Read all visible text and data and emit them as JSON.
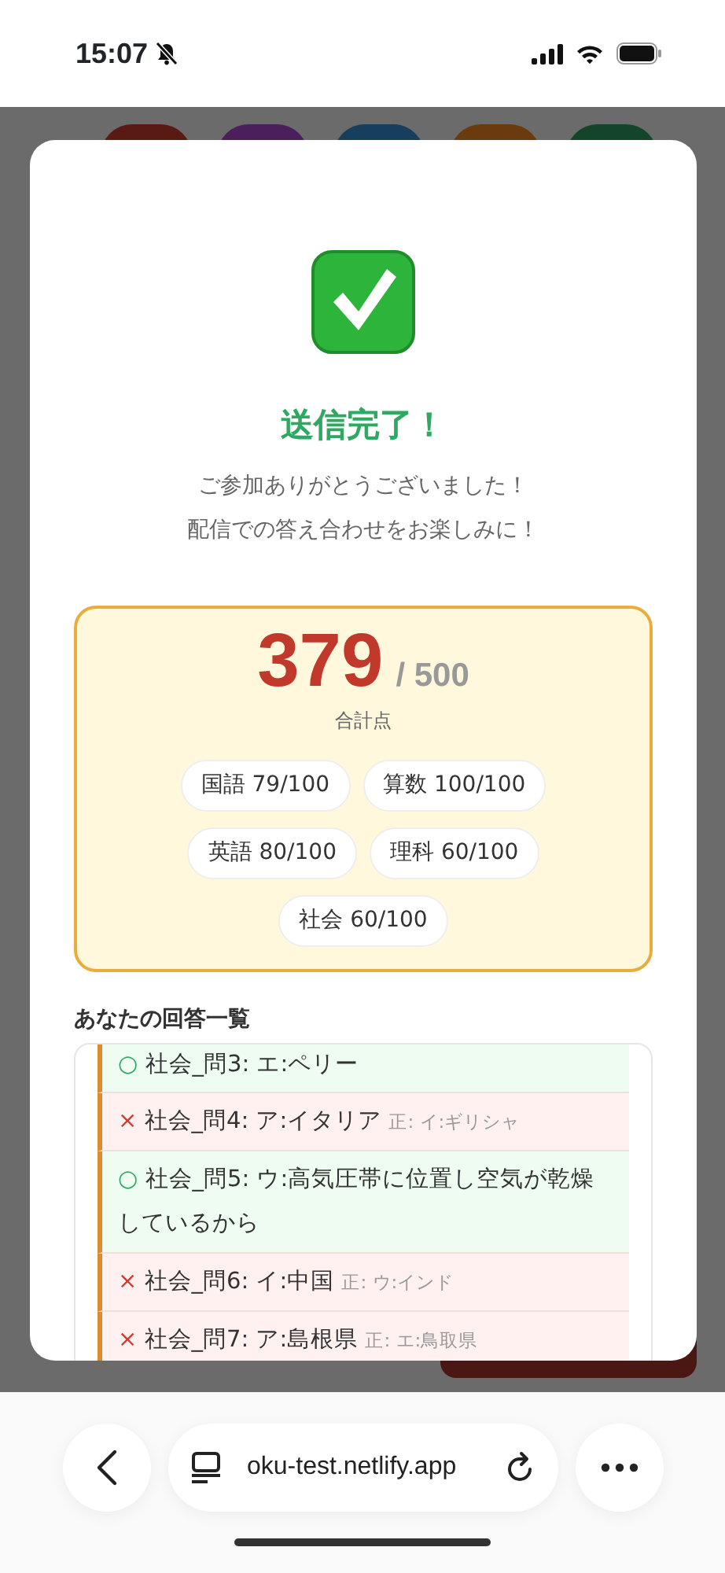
{
  "status_bar": {
    "time": "15:07",
    "silent": true
  },
  "background_tabs": [
    {
      "color": "#5a1a14"
    },
    {
      "color": "#4a1f5c"
    },
    {
      "color": "#173e5c"
    },
    {
      "color": "#6b3a0e"
    },
    {
      "color": "#14452a"
    }
  ],
  "modal": {
    "title": "送信完了！",
    "message": [
      "ご参加ありがとうございました！",
      "配信での答え合わせをお楽しみに！"
    ],
    "score": {
      "total": "379",
      "max": "/ 500",
      "label": "合計点"
    },
    "subjects": [
      "国語 79/100",
      "算数 100/100",
      "英語 80/100",
      "理科 60/100",
      "社会 60/100"
    ],
    "answers_heading": "あなたの回答一覧",
    "answers": [
      {
        "correct": true,
        "mark": "○",
        "text": "社会_問3: エ:ペリー"
      },
      {
        "correct": false,
        "mark": "×",
        "text": "社会_問4: ア:イタリア",
        "correct_answer": "正: イ:ギリシャ"
      },
      {
        "correct": true,
        "mark": "○",
        "text": "社会_問5: ウ:高気圧帯に位置し空気が乾燥しているから"
      },
      {
        "correct": false,
        "mark": "×",
        "text": "社会_問6: イ:中国",
        "correct_answer": "正: ウ:インド"
      },
      {
        "correct": false,
        "mark": "×",
        "text": "社会_問7: ア:島根県",
        "correct_answer": "正: エ:鳥取県"
      }
    ]
  },
  "browser_bar": {
    "url": "oku-test.netlify.app"
  }
}
